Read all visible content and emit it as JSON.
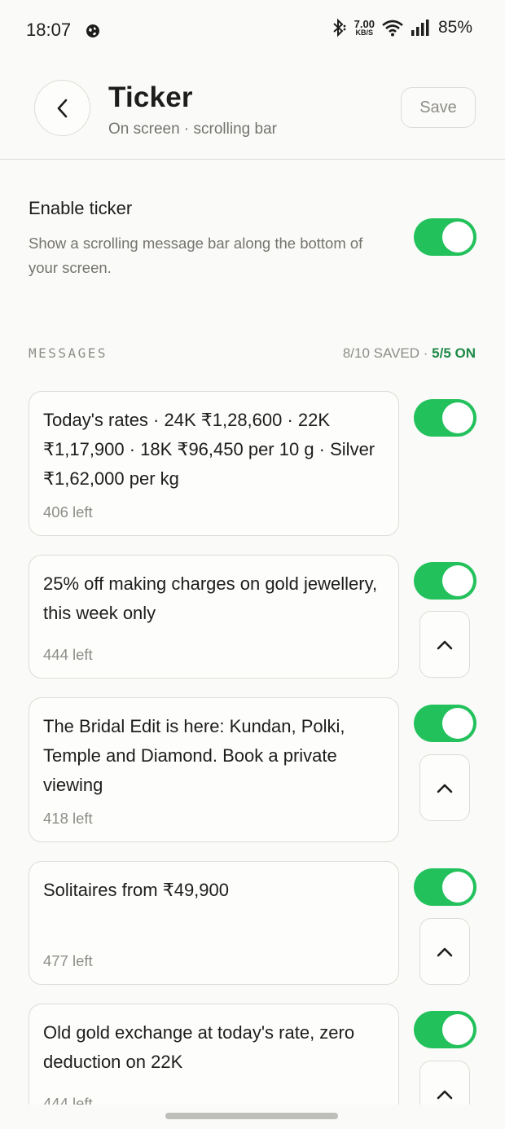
{
  "status_bar": {
    "time": "18:07",
    "net_speed_value": "7.00",
    "net_speed_unit": "KB/S",
    "battery": "85%"
  },
  "header": {
    "title": "Ticker",
    "subtitle": "On screen · scrolling bar",
    "save_label": "Save"
  },
  "enable": {
    "title": "Enable ticker",
    "description": "Show a scrolling message bar along the bottom of your screen.",
    "enabled": true
  },
  "messages_section": {
    "label": "MESSAGES",
    "saved_count": "8/10 SAVED",
    "separator": " · ",
    "on_count": "5/5 ON"
  },
  "messages": [
    {
      "text": "Today's rates · 24K ₹1,28,600 · 22K ₹1,17,900 · 18K ₹96,450 per 10 g · Silver ₹1,62,000 per kg",
      "chars_left": "406 left",
      "enabled": true
    },
    {
      "text": "25% off making charges on gold jewellery, this week only",
      "chars_left": "444 left",
      "enabled": true
    },
    {
      "text": "The Bridal Edit is here: Kundan, Polki, Temple and Diamond. Book a private viewing",
      "chars_left": "418 left",
      "enabled": true
    },
    {
      "text": "Solitaires from ₹49,900",
      "chars_left": "477 left",
      "enabled": true
    },
    {
      "text": "Old gold exchange at today's rate, zero deduction on 22K",
      "chars_left": "444 left",
      "enabled": true
    }
  ],
  "colors": {
    "accent_green": "#23c15c",
    "on_count_green": "#1d8a46",
    "background": "#fafaf8",
    "muted_text": "#74736e"
  },
  "icons": {
    "back": "chevron-left-icon",
    "move_up": "chevron-up-icon",
    "globe": "globe-icon",
    "bluetooth": "bluetooth-icon",
    "wifi": "wifi-icon",
    "signal": "signal-icon"
  }
}
